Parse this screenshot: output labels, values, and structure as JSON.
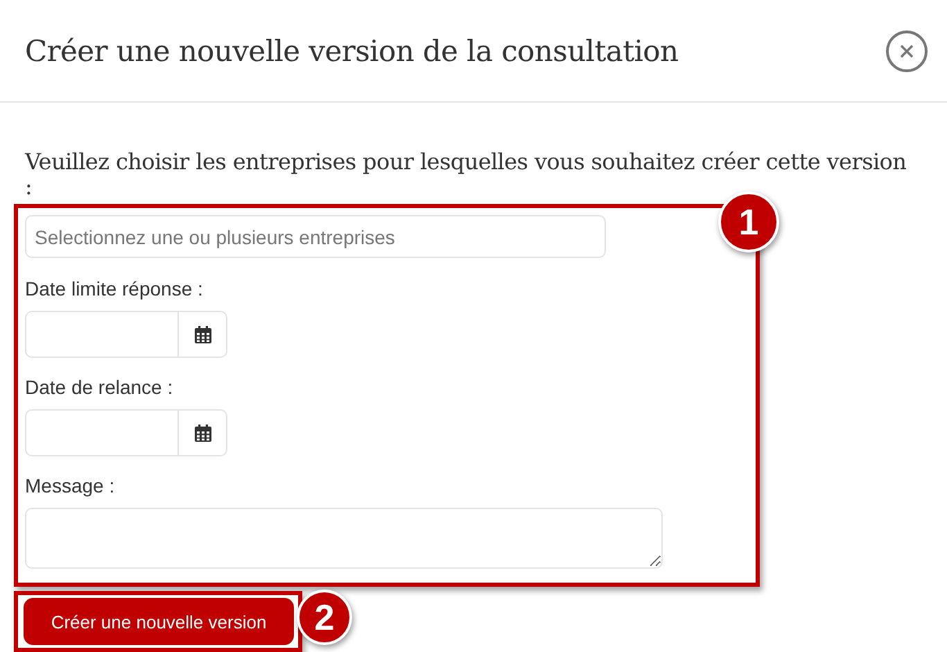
{
  "dialog": {
    "title": "Créer une nouvelle version de la consultation"
  },
  "instruction": "Veuillez choisir les entreprises pour lesquelles vous souhaitez créer cette version :",
  "fields": [
    {
      "kind": "select",
      "placeholder": "Selectionnez une ou plusieurs entreprises"
    },
    {
      "kind": "date",
      "label": "Date limite réponse :"
    },
    {
      "kind": "date",
      "label": "Date de relance :"
    },
    {
      "kind": "textarea",
      "label": "Message :"
    }
  ],
  "submit_button": "Créer une nouvelle version",
  "callouts": [
    "1",
    "2"
  ]
}
